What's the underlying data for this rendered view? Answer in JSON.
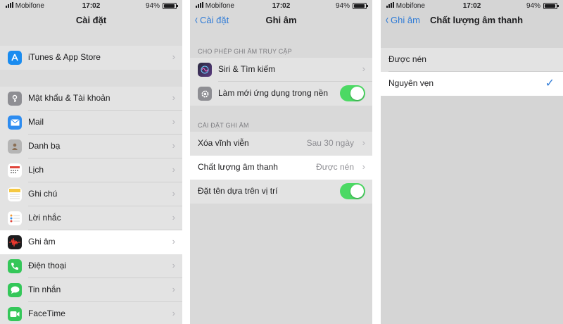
{
  "status_bar": {
    "carrier": "Mobifone",
    "time": "17:02",
    "battery": "94%"
  },
  "screens": {
    "settings": {
      "title": "Cài đặt",
      "group1": [
        {
          "label": "iTunes & App Store",
          "icon": "app-store-icon",
          "color": "#1a8cf0"
        }
      ],
      "group2": [
        {
          "label": "Mật khẩu & Tài khoản",
          "icon": "key-icon",
          "color": "#8e8e93"
        },
        {
          "label": "Mail",
          "icon": "mail-icon",
          "color": "#2d8cf0"
        },
        {
          "label": "Danh bạ",
          "icon": "contacts-icon",
          "color": "#a0a0a0"
        },
        {
          "label": "Lịch",
          "icon": "calendar-icon",
          "color": "#ffffff"
        },
        {
          "label": "Ghi chú",
          "icon": "notes-icon",
          "color": "#ffffff"
        },
        {
          "label": "Lời nhắc",
          "icon": "reminders-icon",
          "color": "#ffffff"
        },
        {
          "label": "Ghi âm",
          "icon": "voice-memos-icon",
          "color": "#1c1c1e",
          "highlighted": true
        },
        {
          "label": "Điện thoại",
          "icon": "phone-icon",
          "color": "#34c759"
        },
        {
          "label": "Tin nhắn",
          "icon": "messages-icon",
          "color": "#34c759"
        },
        {
          "label": "FaceTime",
          "icon": "facetime-icon",
          "color": "#34c759"
        }
      ]
    },
    "voice_memos": {
      "back": "Cài đặt",
      "title": "Ghi âm",
      "section1_header": "CHO PHÉP GHI ÂM TRUY CẬP",
      "section1": [
        {
          "label": "Siri & Tìm kiếm",
          "icon": "siri-icon",
          "color": "#3a3a50"
        },
        {
          "label": "Làm mới ứng dụng trong nền",
          "icon": "gear-icon",
          "color": "#8e8e93",
          "toggle": true
        }
      ],
      "section2_header": "CÀI ĐẶT GHI ÂM",
      "section2": [
        {
          "label": "Xóa vĩnh viễn",
          "value": "Sau 30 ngày"
        },
        {
          "label": "Chất lượng âm thanh",
          "value": "Được nén",
          "highlighted": true
        },
        {
          "label": "Đặt tên dựa trên vị trí",
          "toggle": true
        }
      ]
    },
    "audio_quality": {
      "back": "Ghi âm",
      "title": "Chất lượng âm thanh",
      "options": [
        {
          "label": "Được nén",
          "selected": false
        },
        {
          "label": "Nguyên vẹn",
          "selected": true
        }
      ]
    }
  },
  "colors": {
    "accent": "#2f7bd6",
    "toggle_on": "#4cd964"
  }
}
